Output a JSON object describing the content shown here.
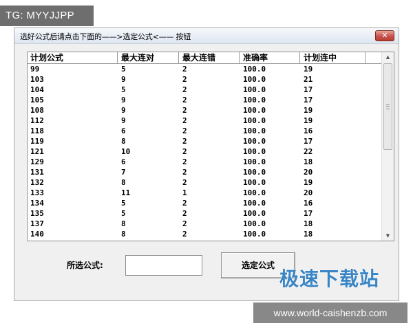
{
  "overlay_label": "TG: MYYJJPP",
  "window": {
    "title": "选好公式后请点击下面的——>选定公式<——   按钮",
    "close_glyph": "✕"
  },
  "table": {
    "columns": [
      "计划公式",
      "最大连对",
      "最大连错",
      "准确率",
      "计划连中"
    ],
    "rows": [
      [
        "99",
        "5",
        "2",
        "100.0",
        "19"
      ],
      [
        "103",
        "9",
        "2",
        "100.0",
        "21"
      ],
      [
        "104",
        "5",
        "2",
        "100.0",
        "17"
      ],
      [
        "105",
        "9",
        "2",
        "100.0",
        "17"
      ],
      [
        "108",
        "9",
        "2",
        "100.0",
        "19"
      ],
      [
        "112",
        "9",
        "2",
        "100.0",
        "19"
      ],
      [
        "118",
        "6",
        "2",
        "100.0",
        "16"
      ],
      [
        "119",
        "8",
        "2",
        "100.0",
        "17"
      ],
      [
        "121",
        "10",
        "2",
        "100.0",
        "22"
      ],
      [
        "129",
        "6",
        "2",
        "100.0",
        "18"
      ],
      [
        "131",
        "7",
        "2",
        "100.0",
        "20"
      ],
      [
        "132",
        "8",
        "2",
        "100.0",
        "19"
      ],
      [
        "133",
        "11",
        "1",
        "100.0",
        "20"
      ],
      [
        "134",
        "5",
        "2",
        "100.0",
        "16"
      ],
      [
        "135",
        "5",
        "2",
        "100.0",
        "17"
      ],
      [
        "137",
        "8",
        "2",
        "100.0",
        "18"
      ],
      [
        "140",
        "8",
        "2",
        "100.0",
        "18"
      ]
    ],
    "scroll_up_glyph": "▲",
    "scroll_down_glyph": "▼"
  },
  "form": {
    "formula_label": "所选公式:",
    "formula_value": "",
    "select_button_label": "选定公式"
  },
  "watermark": {
    "logo_text": "极速下载站",
    "url_text": "www.world-caishenzb.com"
  }
}
